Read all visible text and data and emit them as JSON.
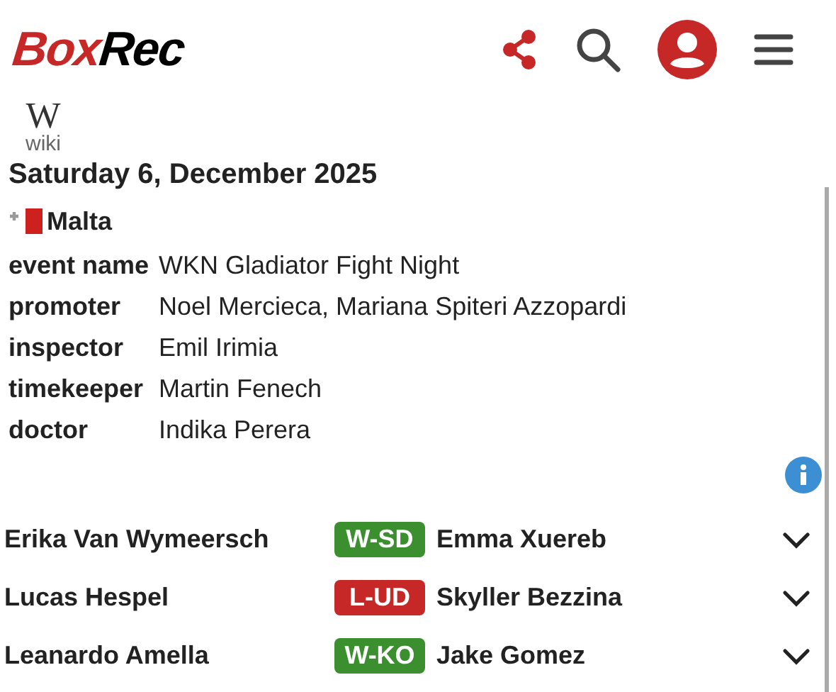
{
  "header": {
    "logo": {
      "part_1": "Box",
      "part_2": "Rec"
    }
  },
  "wiki": {
    "symbol": "W",
    "label": "wiki"
  },
  "date": "Saturday 6, December 2025",
  "country": "Malta",
  "details": [
    {
      "label": "event name",
      "value": "WKN Gladiator Fight Night"
    },
    {
      "label": "promoter",
      "value": "Noel Mercieca, Mariana Spiteri Azzopardi"
    },
    {
      "label": "inspector",
      "value": "Emil Irimia"
    },
    {
      "label": "timekeeper",
      "value": "Martin Fenech"
    },
    {
      "label": "doctor",
      "value": "Indika Perera"
    }
  ],
  "bouts": [
    {
      "fighter": "Erika Van Wymeersch",
      "result": "W-SD",
      "color": "#3b8f2f",
      "opponent": "Emma Xuereb"
    },
    {
      "fighter": "Lucas Hespel",
      "result": "L-UD",
      "color": "#c62828",
      "opponent": "Skyller Bezzina"
    },
    {
      "fighter": "Leanardo Amella",
      "result": "W-KO",
      "color": "#3b8f2f",
      "opponent": "Jake Gomez"
    }
  ]
}
